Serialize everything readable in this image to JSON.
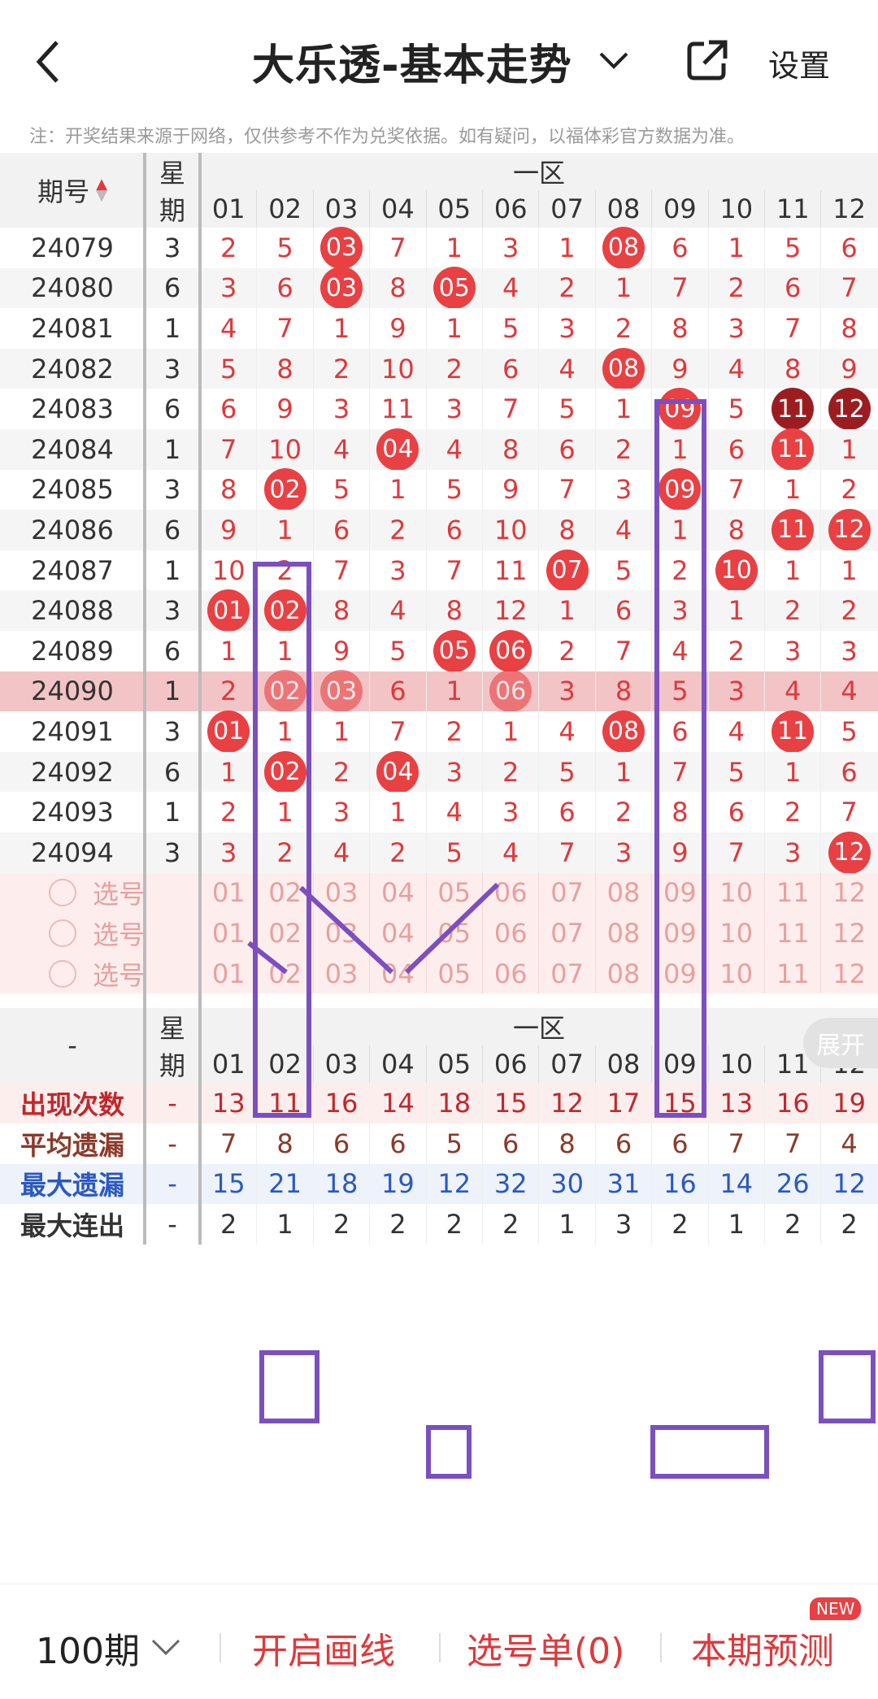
{
  "header": {
    "title": "大乐透-基本走势",
    "settings_label": "设置"
  },
  "notice": "注：开奖结果来源于网络，仅供参考不作为兑奖依据。如有疑问，以福体彩官方数据为准。",
  "table_header": {
    "issue_label": "期号",
    "week_label_1": "星",
    "week_label_2": "期",
    "zone_label": "一区",
    "columns": [
      "01",
      "02",
      "03",
      "04",
      "05",
      "06",
      "07",
      "08",
      "09",
      "10",
      "11",
      "12"
    ]
  },
  "rows": [
    {
      "issue": "24079",
      "week": "3",
      "cells": [
        "2",
        "5",
        "03",
        "7",
        "1",
        "3",
        "1",
        "08",
        "6",
        "1",
        "5",
        "6"
      ],
      "hits": [
        2,
        7
      ]
    },
    {
      "issue": "24080",
      "week": "6",
      "cells": [
        "3",
        "6",
        "03",
        "8",
        "05",
        "4",
        "2",
        "1",
        "7",
        "2",
        "6",
        "7"
      ],
      "hits": [
        2,
        4
      ]
    },
    {
      "issue": "24081",
      "week": "1",
      "cells": [
        "4",
        "7",
        "1",
        "9",
        "1",
        "5",
        "3",
        "2",
        "8",
        "3",
        "7",
        "8"
      ],
      "hits": []
    },
    {
      "issue": "24082",
      "week": "3",
      "cells": [
        "5",
        "8",
        "2",
        "10",
        "2",
        "6",
        "4",
        "08",
        "9",
        "4",
        "8",
        "9"
      ],
      "hits": [
        7
      ]
    },
    {
      "issue": "24083",
      "week": "6",
      "cells": [
        "6",
        "9",
        "3",
        "11",
        "3",
        "7",
        "5",
        "1",
        "09",
        "5",
        "11",
        "12"
      ],
      "hits": [
        8,
        10,
        11
      ],
      "dark": [
        10,
        11
      ]
    },
    {
      "issue": "24084",
      "week": "1",
      "cells": [
        "7",
        "10",
        "4",
        "04",
        "4",
        "8",
        "6",
        "2",
        "1",
        "6",
        "11",
        "1"
      ],
      "hits": [
        3,
        10
      ]
    },
    {
      "issue": "24085",
      "week": "3",
      "cells": [
        "8",
        "02",
        "5",
        "1",
        "5",
        "9",
        "7",
        "3",
        "09",
        "7",
        "1",
        "2"
      ],
      "hits": [
        1,
        8
      ]
    },
    {
      "issue": "24086",
      "week": "6",
      "cells": [
        "9",
        "1",
        "6",
        "2",
        "6",
        "10",
        "8",
        "4",
        "1",
        "8",
        "11",
        "12"
      ],
      "hits": [
        10,
        11
      ]
    },
    {
      "issue": "24087",
      "week": "1",
      "cells": [
        "10",
        "2",
        "7",
        "3",
        "7",
        "11",
        "07",
        "5",
        "2",
        "10",
        "1",
        "1"
      ],
      "hits": [
        6,
        9
      ]
    },
    {
      "issue": "24088",
      "week": "3",
      "cells": [
        "01",
        "02",
        "8",
        "4",
        "8",
        "12",
        "1",
        "6",
        "3",
        "1",
        "2",
        "2"
      ],
      "hits": [
        0,
        1
      ]
    },
    {
      "issue": "24089",
      "week": "6",
      "cells": [
        "1",
        "1",
        "9",
        "5",
        "05",
        "06",
        "2",
        "7",
        "4",
        "2",
        "3",
        "3"
      ],
      "hits": [
        4,
        5
      ]
    },
    {
      "issue": "24090",
      "week": "1",
      "cells": [
        "2",
        "02",
        "03",
        "6",
        "1",
        "06",
        "3",
        "8",
        "5",
        "3",
        "4",
        "4"
      ],
      "hits": [
        1,
        2,
        5
      ],
      "highlight": true
    },
    {
      "issue": "24091",
      "week": "3",
      "cells": [
        "01",
        "1",
        "1",
        "7",
        "2",
        "1",
        "4",
        "08",
        "6",
        "4",
        "11",
        "5"
      ],
      "hits": [
        0,
        7,
        10
      ]
    },
    {
      "issue": "24092",
      "week": "6",
      "cells": [
        "1",
        "02",
        "2",
        "04",
        "3",
        "2",
        "5",
        "1",
        "7",
        "5",
        "1",
        "6"
      ],
      "hits": [
        1,
        3
      ]
    },
    {
      "issue": "24093",
      "week": "1",
      "cells": [
        "2",
        "1",
        "3",
        "1",
        "4",
        "3",
        "6",
        "2",
        "8",
        "6",
        "2",
        "7"
      ],
      "hits": []
    },
    {
      "issue": "24094",
      "week": "3",
      "cells": [
        "3",
        "2",
        "4",
        "2",
        "5",
        "4",
        "7",
        "3",
        "9",
        "7",
        "3",
        "12"
      ],
      "hits": [
        11
      ]
    }
  ],
  "pick_rows": [
    {
      "label": "选号",
      "nums": [
        "01",
        "02",
        "03",
        "04",
        "05",
        "06",
        "07",
        "08",
        "09",
        "10",
        "11",
        "12"
      ]
    },
    {
      "label": "选号",
      "nums": [
        "01",
        "02",
        "03",
        "04",
        "05",
        "06",
        "07",
        "08",
        "09",
        "10",
        "11",
        "12"
      ]
    },
    {
      "label": "选号",
      "nums": [
        "01",
        "02",
        "03",
        "04",
        "05",
        "06",
        "07",
        "08",
        "09",
        "10",
        "11",
        "12"
      ]
    }
  ],
  "stats_header": {
    "dash": "-",
    "week_label_1": "星",
    "week_label_2": "期",
    "zone_label": "一区",
    "expand_label": "展开"
  },
  "stats": [
    {
      "label": "出现次数",
      "color": "#c0282c",
      "dash": "-",
      "values": [
        "13",
        "11",
        "16",
        "14",
        "18",
        "15",
        "12",
        "17",
        "15",
        "13",
        "16",
        "19"
      ]
    },
    {
      "label": "平均遗漏",
      "color": "#8a3a2a",
      "dash": "-",
      "values": [
        "7",
        "8",
        "6",
        "6",
        "5",
        "6",
        "8",
        "6",
        "6",
        "7",
        "7",
        "4"
      ]
    },
    {
      "label": "最大遗漏",
      "color": "#2a59c0",
      "dash": "-",
      "values": [
        "15",
        "21",
        "18",
        "19",
        "12",
        "32",
        "30",
        "31",
        "16",
        "14",
        "26",
        "12"
      ]
    },
    {
      "label": "最大连出",
      "color": "#333333",
      "dash": "-",
      "values": [
        "2",
        "1",
        "2",
        "2",
        "2",
        "2",
        "1",
        "3",
        "2",
        "1",
        "2",
        "2"
      ]
    }
  ],
  "bottom_bar": {
    "period_label": "100期",
    "draw_line_label": "开启画线",
    "pick_list_label": "选号单(0)",
    "predict_label": "本期预测",
    "new_badge": "NEW"
  },
  "colors": {
    "ball_red": "#e94043",
    "ball_dark": "#9c1d20",
    "annotation_purple": "#7b4fc0"
  }
}
